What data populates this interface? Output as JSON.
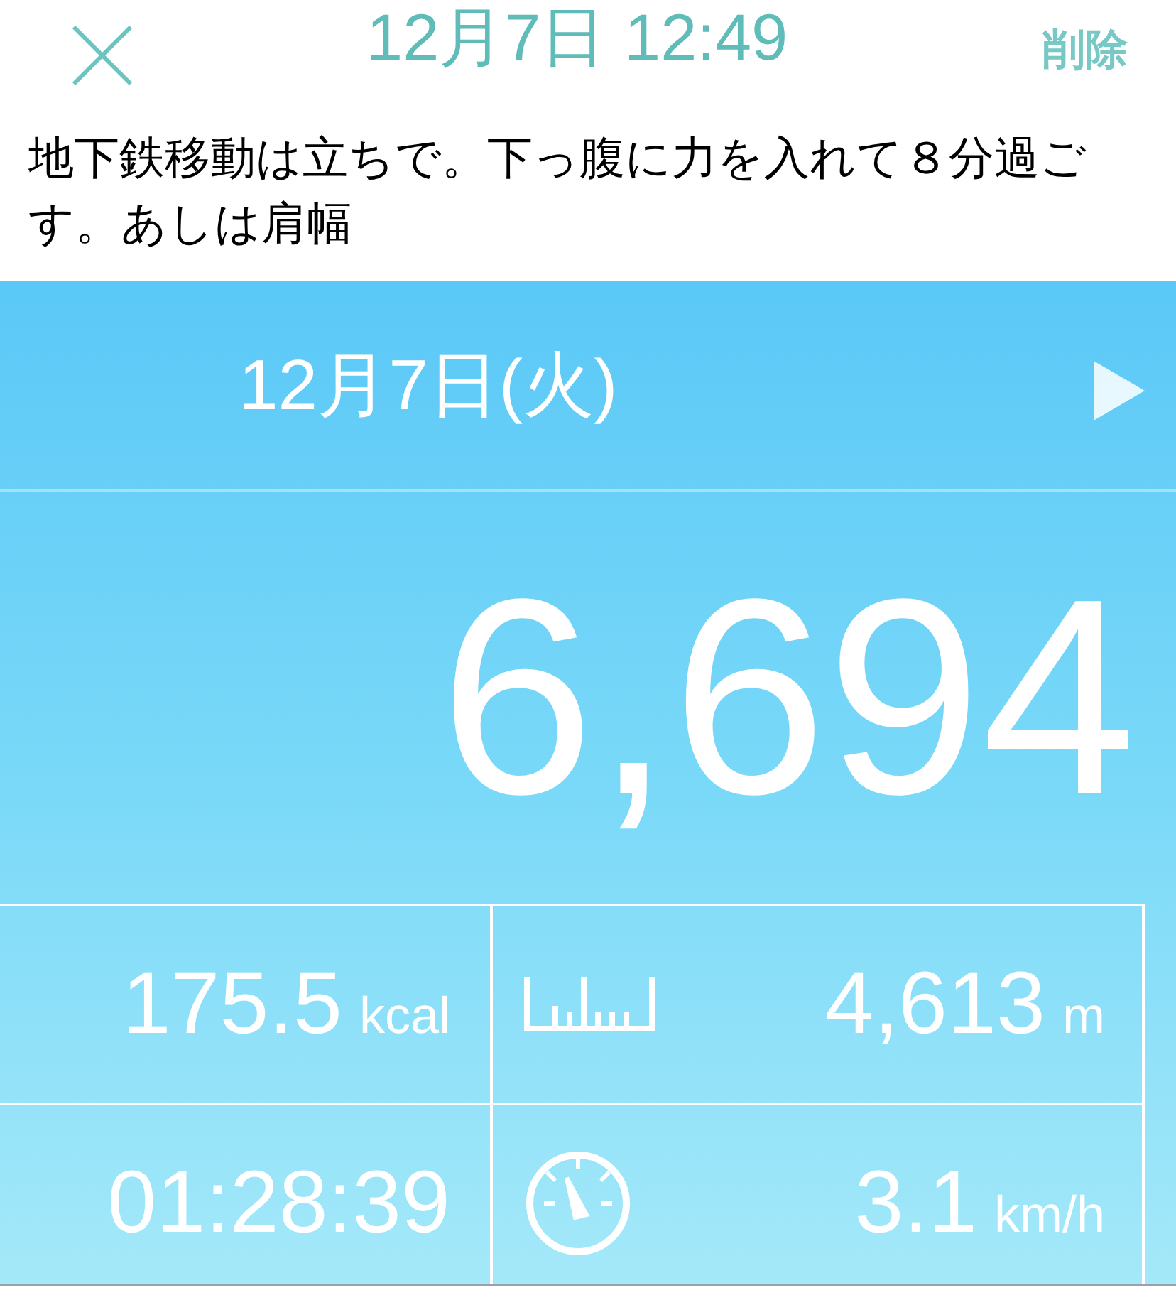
{
  "header": {
    "title": "12月7日 12:49",
    "action": "削除"
  },
  "note": "地下鉄移動は立ちで。下っ腹に力を入れて８分過ごす。あしは肩幅",
  "day": {
    "label": "12月7日(火)"
  },
  "steps": "6,694",
  "stats": [
    {
      "kind": "plain",
      "value": "175.5",
      "unit": "kcal"
    },
    {
      "kind": "ruler",
      "value": "4,613",
      "unit": "m"
    },
    {
      "kind": "plain",
      "value": "01:28:39"
    },
    {
      "kind": "speedometer",
      "value": "3.1",
      "unit": "km/h"
    }
  ]
}
